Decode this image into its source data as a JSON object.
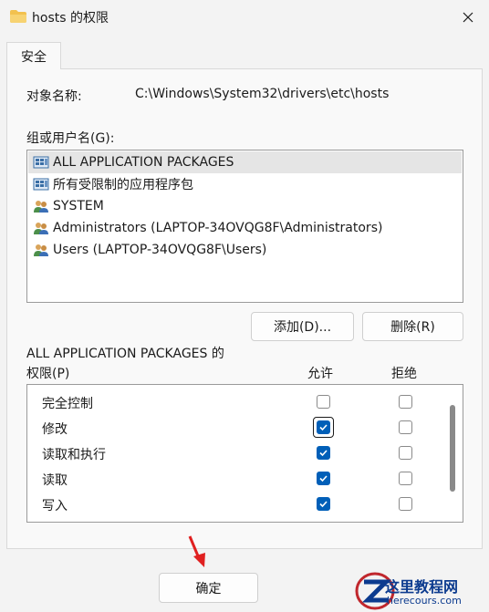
{
  "window": {
    "title": "hosts 的权限",
    "tab": "安全"
  },
  "object": {
    "label": "对象名称:",
    "value": "C:\\Windows\\System32\\drivers\\etc\\hosts"
  },
  "groups": {
    "label": "组或用户名(G):",
    "items": [
      {
        "label": "ALL APPLICATION PACKAGES",
        "icon": "package-group-icon",
        "selected": true
      },
      {
        "label": "所有受限制的应用程序包",
        "icon": "package-group-icon",
        "selected": false
      },
      {
        "label": "SYSTEM",
        "icon": "users-icon",
        "selected": false
      },
      {
        "label": "Administrators (LAPTOP-34OVQG8F\\Administrators)",
        "icon": "users-icon",
        "selected": false
      },
      {
        "label": "Users (LAPTOP-34OVQG8F\\Users)",
        "icon": "users-icon",
        "selected": false
      }
    ],
    "add_label": "添加(D)...",
    "remove_label": "删除(R)"
  },
  "permissions": {
    "for_label": "ALL APPLICATION PACKAGES 的",
    "label": "权限(P)",
    "allow_header": "允许",
    "deny_header": "拒绝",
    "rows": [
      {
        "name": "完全控制",
        "allow": false,
        "deny": false
      },
      {
        "name": "修改",
        "allow": true,
        "deny": false
      },
      {
        "name": "读取和执行",
        "allow": true,
        "deny": false
      },
      {
        "name": "读取",
        "allow": true,
        "deny": false
      },
      {
        "name": "写入",
        "allow": true,
        "deny": false
      }
    ]
  },
  "footer": {
    "ok_label": "确定"
  },
  "watermark": {
    "title": "这里教程网",
    "url": "herecours.com"
  },
  "colors": {
    "accent": "#005fb8",
    "arrow": "#e02020",
    "watermark": "#0c3b8f"
  }
}
